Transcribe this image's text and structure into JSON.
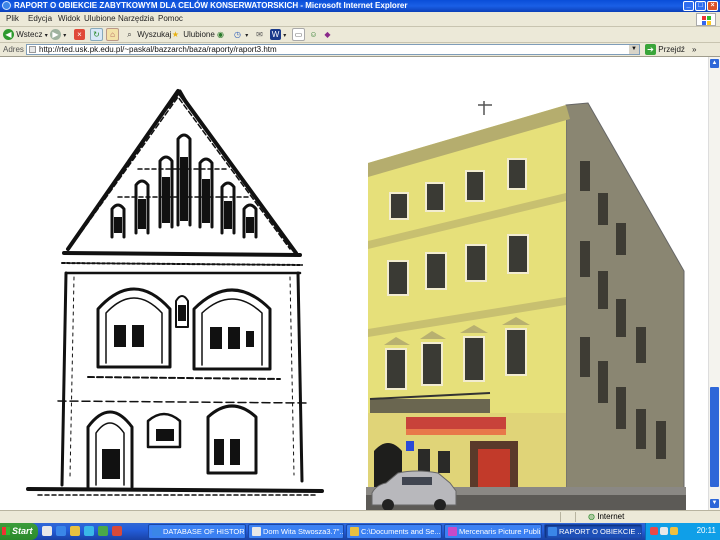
{
  "window": {
    "title": "RAPORT O OBIEKCIE ZABYTKOWYM DLA CELÓW KONSERWATORSKICH - Microsoft Internet Explorer",
    "buttons": [
      "_",
      "□",
      "×"
    ]
  },
  "menu": [
    "Plik",
    "Edycja",
    "Widok",
    "Ulubione",
    "Narzędzia",
    "Pomoc"
  ],
  "toolbar": {
    "back_label": "Wstecz",
    "search_label": "Wyszukaj",
    "favorites_label": "Ulubione"
  },
  "address": {
    "label": "Adres",
    "url": "http://rted.usk.pk.edu.pl/~paskal/bazzarch/baza/raporty/raport3.htm",
    "go_label": "Przejdź",
    "links_label": "»"
  },
  "status": {
    "text": "",
    "zone": "Internet"
  },
  "taskbar": {
    "start_label": "Start",
    "tasks": [
      {
        "label": "DATABASE OF HISTORI..."
      },
      {
        "label": "Dom Wita Stwosza3.7\"..."
      },
      {
        "label": "C:\\Documents and Se..."
      },
      {
        "label": "Mercenaris Picture Publi..."
      },
      {
        "label": "RAPORT O OBIEKCIE ..."
      }
    ],
    "clock": "20:11"
  },
  "colors": {
    "titlebar": "#0a4ed8",
    "chrome": "#ece9d8",
    "taskbar": "#245edb",
    "start": "#2a8a2a",
    "facade_yellow": "#e6e07a"
  }
}
